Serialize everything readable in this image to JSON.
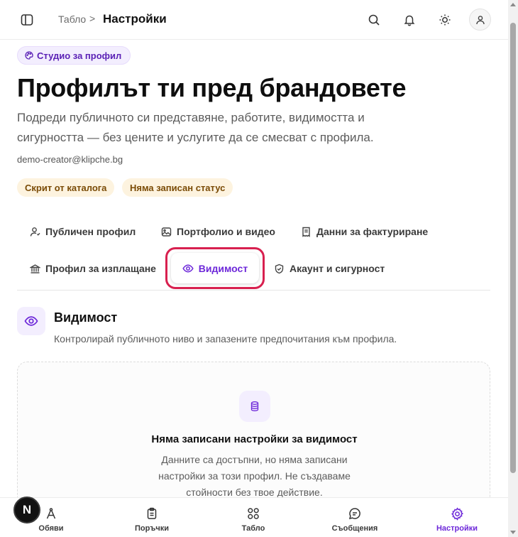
{
  "topbar": {
    "breadcrumb_root": "Табло",
    "breadcrumb_separator": ">",
    "breadcrumb_current": "Настройки"
  },
  "header": {
    "studio_pill": "Студио за профил",
    "title": "Профилът ти пред брандовете",
    "subtitle": "Подреди публичното си представяне, работите, видимостта и сигурността — без цените и услугите да се смесват с профила.",
    "email": "demo-creator@klipche.bg",
    "badges": [
      "Скрит от каталога",
      "Няма записан статус"
    ]
  },
  "tabs": [
    {
      "label": "Публичен профил",
      "icon": "user-icon"
    },
    {
      "label": "Портфолио и видео",
      "icon": "image-icon"
    },
    {
      "label": "Данни за фактуриране",
      "icon": "receipt-icon"
    },
    {
      "label": "Профил за изплащане",
      "icon": "bank-icon"
    },
    {
      "label": "Видимост",
      "icon": "eye-icon",
      "active": true
    },
    {
      "label": "Акаунт и сигурност",
      "icon": "shield-icon"
    }
  ],
  "section": {
    "title": "Видимост",
    "description": "Контролирай публичното ниво и запазените предпочитания към профила."
  },
  "empty_state": {
    "title": "Няма записани настройки за видимост",
    "description": "Данните са достъпни, но няма записани настройки за този профил. Не създаваме стойности без твое действие."
  },
  "bottom_nav": [
    {
      "label": "Обяви",
      "icon": "compass-icon"
    },
    {
      "label": "Поръчки",
      "icon": "clipboard-icon"
    },
    {
      "label": "Табло",
      "icon": "grid-icon"
    },
    {
      "label": "Съобщения",
      "icon": "chat-icon"
    },
    {
      "label": "Настройки",
      "icon": "gear-icon",
      "active": true
    }
  ],
  "next_badge": "N",
  "colors": {
    "accent": "#6d28d9",
    "highlight_outline": "#d8204f",
    "badge_bg": "#fdf3df",
    "pill_bg": "#f3eefe"
  }
}
